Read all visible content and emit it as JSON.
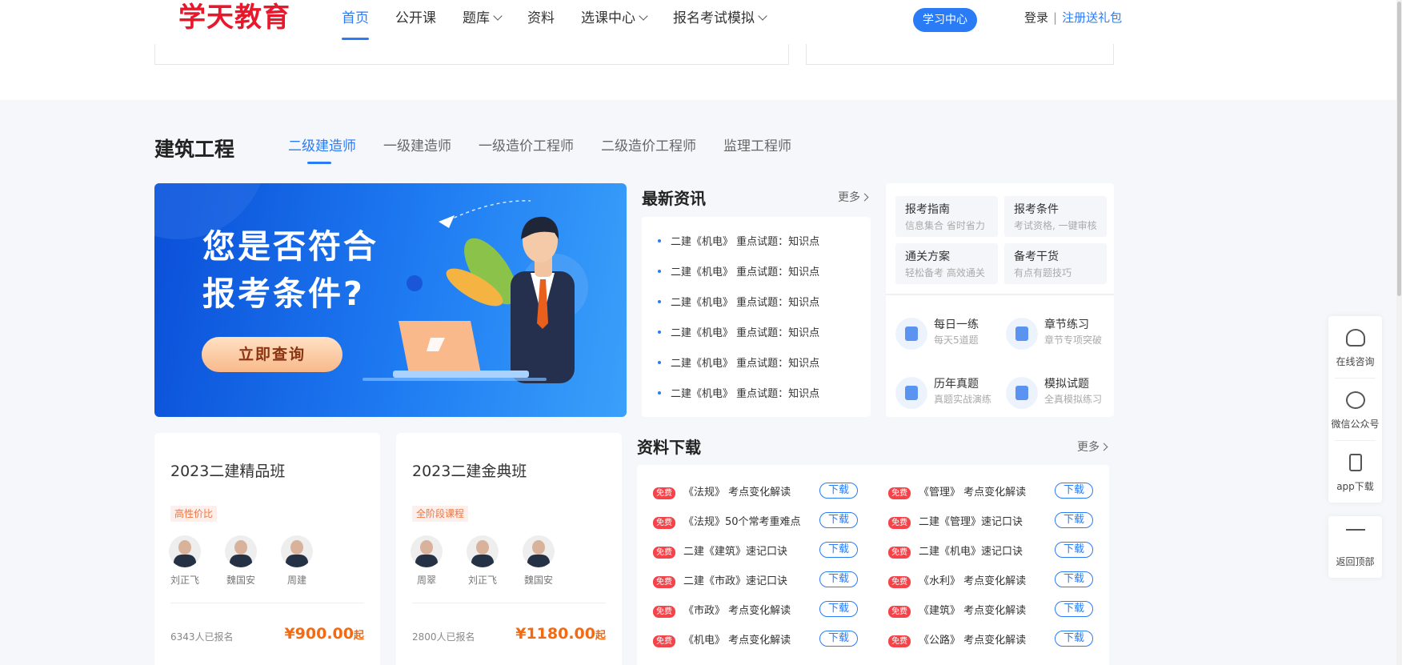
{
  "header": {
    "logo": "学天教育",
    "nav": [
      "首页",
      "公开课",
      "题库",
      "资料",
      "选课中心",
      "报名考试模拟"
    ],
    "study_center": "学习中心",
    "login": "登录",
    "separator": "|",
    "register": "注册送礼包"
  },
  "section": {
    "title": "建筑工程",
    "tabs": [
      "二级建造师",
      "一级建造师",
      "一级造价工程师",
      "二级造价工程师",
      "监理工程师"
    ]
  },
  "banner": {
    "line1": "您是否符合",
    "line2": "报考条件?",
    "button": "立即查询"
  },
  "news": {
    "title": "最新资讯",
    "more": "更多",
    "items": [
      "二建《机电》 重点试题：知识点",
      "二建《机电》 重点试题：知识点",
      "二建《机电》 重点试题：知识点",
      "二建《机电》 重点试题：知识点",
      "二建《机电》 重点试题：知识点",
      "二建《机电》 重点试题：知识点"
    ]
  },
  "guide": {
    "cards": [
      {
        "title": "报考指南",
        "sub": "信息集合 省时省力"
      },
      {
        "title": "报考条件",
        "sub": "考试资格, 一键审核"
      },
      {
        "title": "通关方案",
        "sub": "轻松备考 高效通关"
      },
      {
        "title": "备考干货",
        "sub": "有点有题技巧"
      }
    ],
    "practice": [
      {
        "title": "每日一练",
        "sub": "每天5道题"
      },
      {
        "title": "章节练习",
        "sub": "章节专项突破"
      },
      {
        "title": "历年真题",
        "sub": "真题实战演练"
      },
      {
        "title": "模拟试题",
        "sub": "全真模拟练习"
      }
    ]
  },
  "courses": [
    {
      "title": "2023二建精品班",
      "tag": "高性价比",
      "teachers": [
        "刘正飞",
        "魏国安",
        "周建"
      ],
      "enrolled": "6343人已报名",
      "price": "¥900.00",
      "suffix": "起"
    },
    {
      "title": "2023二建金典班",
      "tag": "全阶段课程",
      "teachers": [
        "周翠",
        "刘正飞",
        "魏国安"
      ],
      "enrolled": "2800人已报名",
      "price": "¥1180.00",
      "suffix": "起"
    }
  ],
  "downloads": {
    "title": "资料下载",
    "more": "更多",
    "free": "免费",
    "button": "下载",
    "items": [
      "《法规》 考点变化解读",
      "《管理》 考点变化解读",
      "《法规》50个常考重难点",
      "二建《管理》速记口诀",
      "二建《建筑》速记口诀",
      "二建《机电》速记口诀",
      "二建《市政》速记口诀",
      "《水利》 考点变化解读",
      "《市政》 考点变化解读",
      "《建筑》 考点变化解读",
      "《机电》 考点变化解读",
      "《公路》 考点变化解读"
    ]
  },
  "floating": {
    "items": [
      "在线咨询",
      "微信公众号",
      "app下载"
    ],
    "top": "返回顶部"
  }
}
